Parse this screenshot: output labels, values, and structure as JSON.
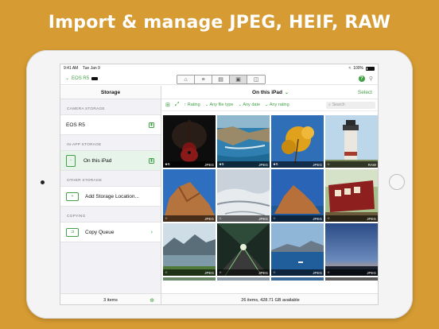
{
  "headline": "Import & manage JPEG, HEIF, RAW",
  "status_bar": {
    "time": "9:41 AM",
    "date": "Tue Jan 9",
    "battery": "100%"
  },
  "toolbar": {
    "camera": "EOS R5",
    "segments": [
      "camera-icon",
      "sliders-icon",
      "storage-icon",
      "photos-icon",
      "gallery-icon"
    ],
    "active_segment": 3
  },
  "sidebar": {
    "title": "Storage",
    "sections": [
      {
        "label": "CAMERA STORAGE",
        "items": [
          {
            "label": "EOS R5"
          }
        ]
      },
      {
        "label": "IN-APP STORAGE",
        "items": [
          {
            "label": "On this iPad"
          }
        ]
      },
      {
        "label": "OTHER STORAGE",
        "items": [
          {
            "label": "Add Storage Location..."
          }
        ]
      },
      {
        "label": "COPYING",
        "items": [
          {
            "label": "Copy Queue"
          }
        ]
      }
    ],
    "footer": "3 items"
  },
  "content": {
    "title": "On this iPad",
    "select": "Select",
    "filters": [
      "Rating",
      "Any file type",
      "Any date",
      "Any rating"
    ],
    "search_placeholder": "Search",
    "footer": "26 items, 428.71 GB available",
    "photos": [
      {
        "rating": "★5",
        "format": "JPEG",
        "subject": "guitar"
      },
      {
        "rating": "★5",
        "format": "JPEG",
        "subject": "coast"
      },
      {
        "rating": "★5",
        "format": "JPEG",
        "subject": "leaves"
      },
      {
        "rating": "☆",
        "format": "RAW",
        "subject": "lighthouse"
      },
      {
        "rating": "☆",
        "format": "JPEG",
        "subject": "rock"
      },
      {
        "rating": "☆",
        "format": "JPEG",
        "subject": "snow"
      },
      {
        "rating": "☆",
        "format": "JPEG",
        "subject": "rock-sea"
      },
      {
        "rating": "☆",
        "format": "JPEG",
        "subject": "train"
      },
      {
        "rating": "☆",
        "format": "JPEG",
        "subject": "lake"
      },
      {
        "rating": "☆",
        "format": "JPEG",
        "subject": "tunnel"
      },
      {
        "rating": "☆",
        "format": "JPEG",
        "subject": "island"
      },
      {
        "rating": "☆",
        "format": "JPEG",
        "subject": "dusk"
      }
    ]
  },
  "colors": {
    "background": "#d69b32",
    "accent": "#43a047"
  }
}
